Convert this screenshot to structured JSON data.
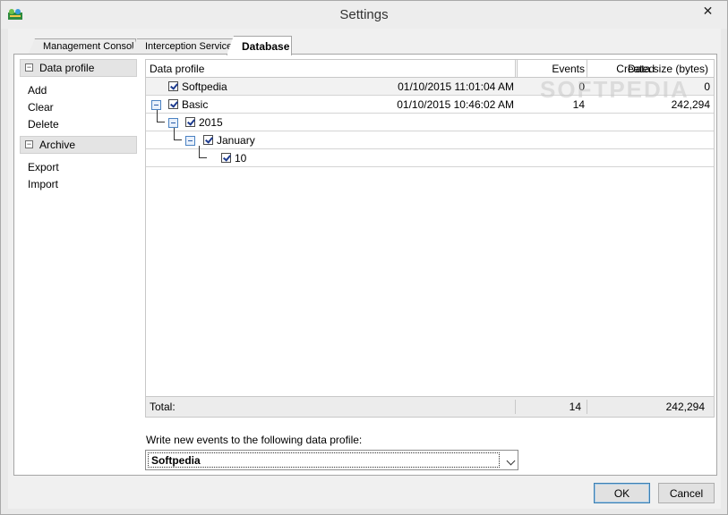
{
  "window": {
    "title": "Settings",
    "close_glyph": "✕"
  },
  "tabs": [
    {
      "label": "Management Console"
    },
    {
      "label": "Interception Service"
    },
    {
      "label": "Database"
    }
  ],
  "nav": {
    "data_profile": {
      "header": "Data profile",
      "items": [
        "Add",
        "Clear",
        "Delete"
      ]
    },
    "archive": {
      "header": "Archive",
      "items": [
        "Export",
        "Import"
      ]
    }
  },
  "grid": {
    "columns": [
      "Data profile",
      "Created",
      "Events",
      "Data size (bytes)"
    ],
    "rows": [
      {
        "name": "Softpedia",
        "created": "01/10/2015 11:01:04 AM",
        "events": "0",
        "size": "0"
      },
      {
        "name": "Basic",
        "created": "01/10/2015 10:46:02 AM",
        "events": "14",
        "size": "242,294"
      },
      {
        "name": "2015",
        "created": "",
        "events": "",
        "size": ""
      },
      {
        "name": "January",
        "created": "",
        "events": "",
        "size": ""
      },
      {
        "name": "10",
        "created": "",
        "events": "",
        "size": ""
      }
    ],
    "footer": {
      "label": "Total:",
      "events": "14",
      "size": "242,294"
    }
  },
  "watermark": "SOFTPEDIA",
  "profile": {
    "label": "Write new events to the following data profile:",
    "selected": "Softpedia"
  },
  "buttons": {
    "ok": "OK",
    "cancel": "Cancel"
  },
  "icons": {
    "app": "app-icon",
    "close": "close-icon",
    "expander": "collapse-icon",
    "checkbox": "checkbox-checked-icon",
    "dropdown": "chevron-down-icon"
  }
}
